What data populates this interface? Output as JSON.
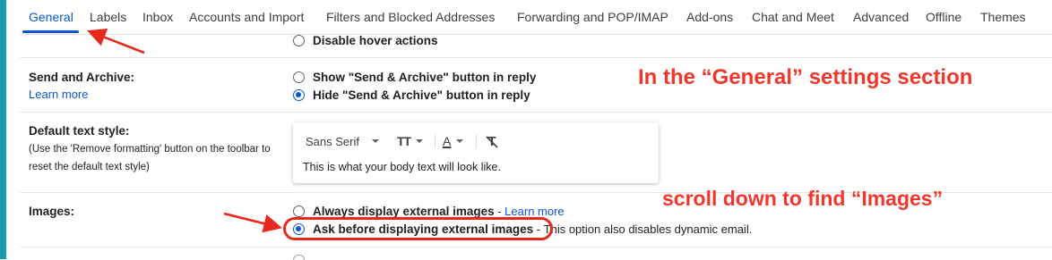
{
  "tabs": [
    {
      "label": "General",
      "active": true
    },
    {
      "label": "Labels"
    },
    {
      "label": "Inbox"
    },
    {
      "label": "Accounts and Import"
    },
    {
      "label": "Filters and Blocked Addresses"
    },
    {
      "label": "Forwarding and POP/IMAP"
    },
    {
      "label": "Add-ons"
    },
    {
      "label": "Chat and Meet"
    },
    {
      "label": "Advanced"
    },
    {
      "label": "Offline"
    },
    {
      "label": "Themes"
    }
  ],
  "hover": {
    "option": "Disable hover actions"
  },
  "send_archive": {
    "label": "Send and Archive:",
    "learn_more": "Learn more",
    "options": [
      {
        "text": "Show \"Send & Archive\" button in reply",
        "checked": false
      },
      {
        "text": "Hide \"Send & Archive\" button in reply",
        "checked": true
      }
    ]
  },
  "text_style": {
    "label": "Default text style:",
    "desc_line1": "(Use the 'Remove formatting' button on the toolbar to",
    "desc_line2": "reset the default text style)",
    "font": "Sans Serif",
    "size_glyph": "TT",
    "color_glyph": "A",
    "clear_glyph": "T",
    "preview": "This is what your body text will look like."
  },
  "images": {
    "label": "Images:",
    "options": [
      {
        "text": "Always display external images",
        "separator": " - ",
        "link": "Learn more",
        "checked": false
      },
      {
        "text": "Ask before displaying external images",
        "separator": " - ",
        "extra": "This option also disables dynamic email.",
        "checked": true
      }
    ]
  },
  "annotations": {
    "top": "In the “General” settings section",
    "middle": "scroll down to find “Images”",
    "color": "#f0372b"
  },
  "colors": {
    "accent": "#0b57d0",
    "annotation": "#f0372b",
    "left_bar": "#1a9bb0"
  }
}
